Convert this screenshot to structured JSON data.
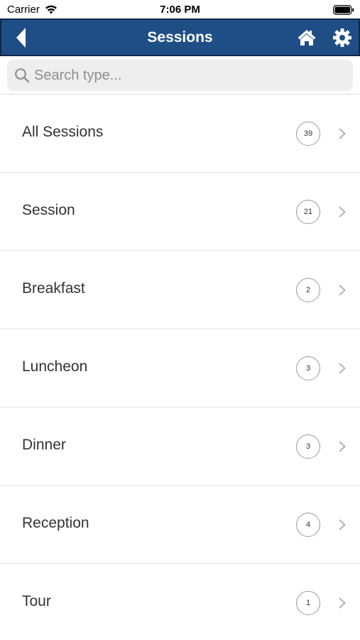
{
  "status_bar": {
    "carrier": "Carrier",
    "time": "7:06 PM",
    "icons": [
      "wifi-icon",
      "battery-icon"
    ]
  },
  "nav": {
    "title": "Sessions",
    "background": "#1f4e86",
    "icons": [
      "back-arrow-icon",
      "home-icon",
      "gear-icon"
    ]
  },
  "search": {
    "placeholder": "Search type...",
    "value": "",
    "icon": "search-icon"
  },
  "session_types": [
    {
      "label": "All Sessions",
      "count": "39"
    },
    {
      "label": "Session",
      "count": "21"
    },
    {
      "label": "Breakfast",
      "count": "2"
    },
    {
      "label": "Luncheon",
      "count": "3"
    },
    {
      "label": "Dinner",
      "count": "3"
    },
    {
      "label": "Reception",
      "count": "4"
    },
    {
      "label": "Tour",
      "count": "1"
    }
  ]
}
